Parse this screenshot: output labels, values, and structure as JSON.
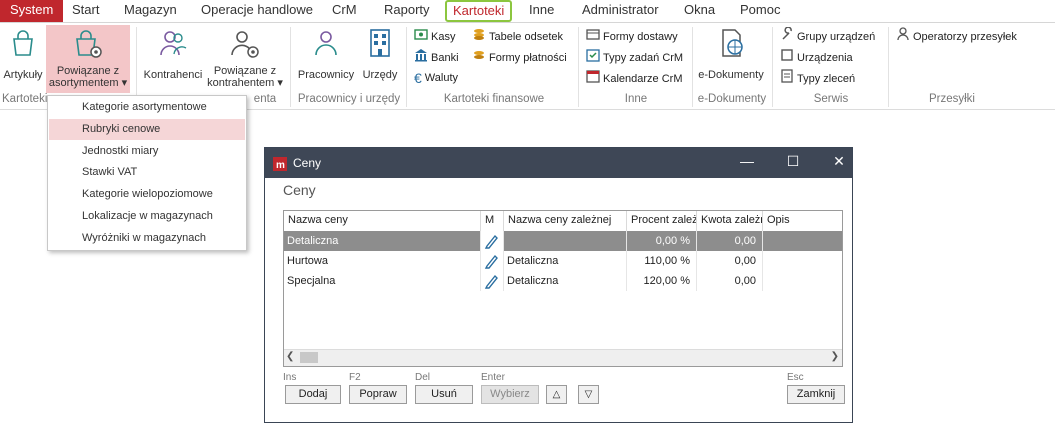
{
  "menubar": {
    "items": [
      "System",
      "Start",
      "Magazyn",
      "Operacje handlowe",
      "CrM",
      "Raporty",
      "Kartoteki",
      "Inne",
      "Administrator",
      "Okna",
      "Pomoc"
    ]
  },
  "ribbon": {
    "btn_artykuly": "Artykuły",
    "btn_powiazane_asort_1": "Powiązane z",
    "btn_powiazane_asort_2": "asortymentem",
    "btn_kontrahenci": "Kontrahenci",
    "btn_powiazane_kontr_1": "Powiązane z",
    "btn_powiazane_kontr_2": "kontrahentem",
    "btn_pracownicy": "Pracownicy",
    "btn_urzedy": "Urzędy",
    "btn_kasy": "Kasy",
    "btn_banki": "Banki",
    "btn_waluty": "Waluty",
    "btn_tabele": "Tabele odsetek",
    "btn_formy_platnosci": "Formy płatności",
    "btn_formy_dostawy": "Formy dostawy",
    "btn_typy_zadan": "Typy zadań CrM",
    "btn_kalendarze": "Kalendarze CrM",
    "btn_edokumenty": "e-Dokumenty",
    "btn_grupy": "Grupy urządzeń",
    "btn_urzadzenia": "Urządzenia",
    "btn_typy_zlecen": "Typy zleceń",
    "btn_operatorzy": "Operatorzy przesyłek",
    "grp_kartoteki": "Kartoteki",
    "grp_kontrahenta_partial": "enta",
    "grp_pracownicy": "Pracownicy i urzędy",
    "grp_finansowe": "Kartoteki finansowe",
    "grp_inne": "Inne",
    "grp_edokumenty": "e-Dokumenty",
    "grp_serwis": "Serwis",
    "grp_przesylki": "Przesyłki"
  },
  "dropdown": {
    "items": [
      "Kategorie asortymentowe",
      "Rubryki cenowe",
      "Jednostki miary",
      "Stawki VAT",
      "Kategorie wielopoziomowe",
      "Lokalizacje w magazynach",
      "Wyróżniki w magazynach"
    ]
  },
  "window": {
    "title": "Ceny",
    "heading": "Ceny",
    "columns": [
      "Nazwa ceny",
      "M",
      "Nazwa ceny zależnej",
      "Procent zależ",
      "Kwota zależn",
      "Opis"
    ],
    "rows": [
      {
        "nazwa": "Detaliczna",
        "zalezna": "",
        "procent": "0,00 %",
        "kwota": "0,00"
      },
      {
        "nazwa": "Hurtowa",
        "zalezna": "Detaliczna",
        "procent": "110,00 %",
        "kwota": "0,00"
      },
      {
        "nazwa": "Specjalna",
        "zalezna": "Detaliczna",
        "procent": "120,00 %",
        "kwota": "0,00"
      }
    ],
    "keys": {
      "ins": "Ins",
      "f2": "F2",
      "del": "Del",
      "enter": "Enter",
      "esc": "Esc"
    },
    "buttons": {
      "dodaj": "Dodaj",
      "popraw": "Popraw",
      "usun": "Usuń",
      "wybierz": "Wybierz",
      "zamknij": "Zamknij"
    }
  },
  "colors": {
    "accent": "#c0272d",
    "highlight": "#8cc63f",
    "titlebar": "#3e4756",
    "selection": "#8d8d8d"
  }
}
